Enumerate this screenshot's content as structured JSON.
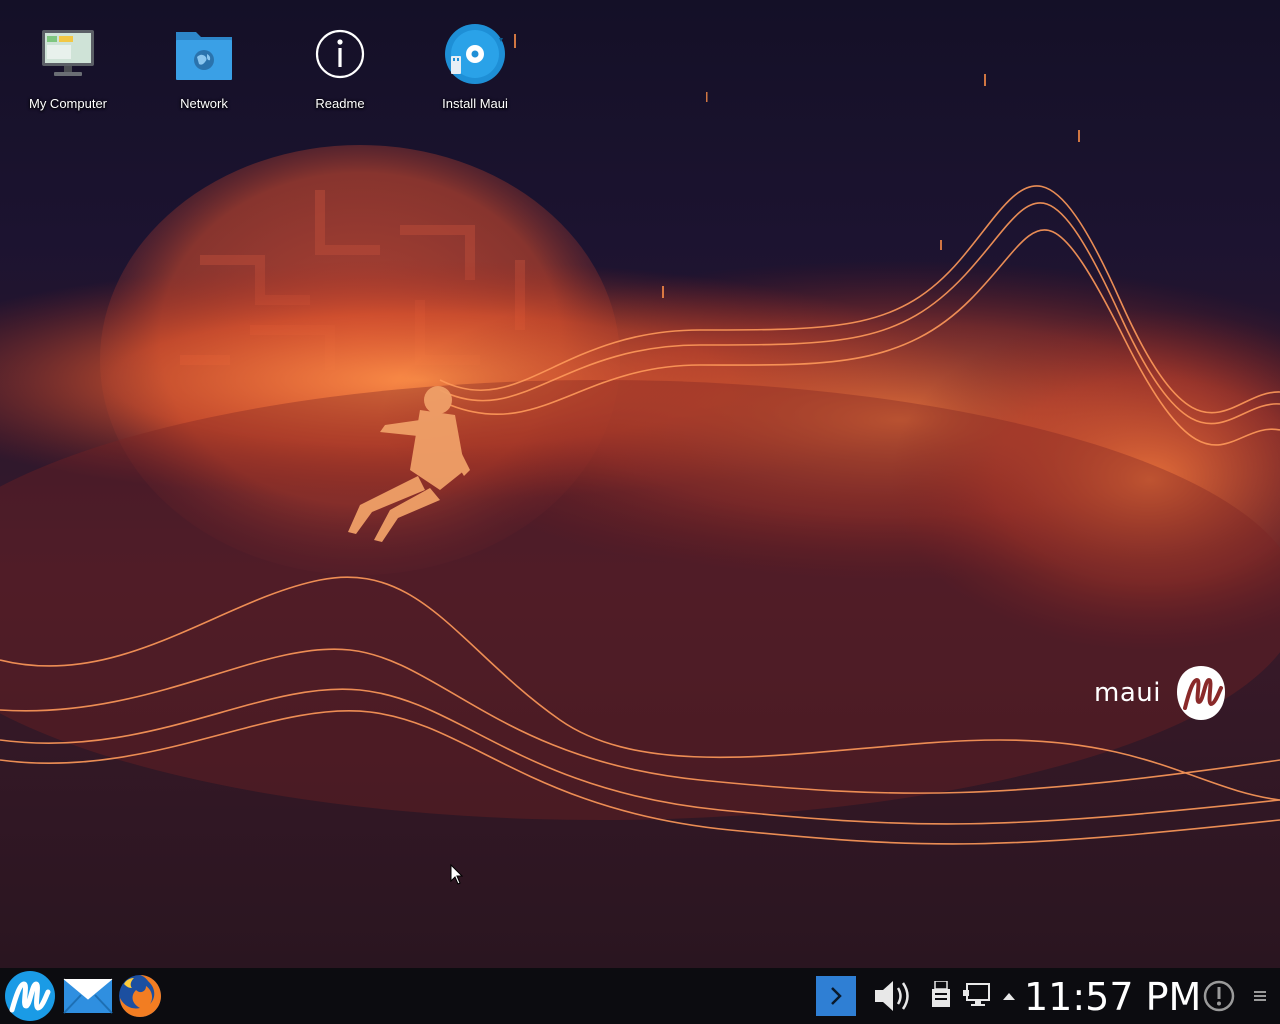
{
  "desktop": {
    "icons": [
      {
        "label": "My Computer",
        "icon": "computer-icon"
      },
      {
        "label": "Network",
        "icon": "network-folder-icon"
      },
      {
        "label": "Readme",
        "icon": "info-icon"
      },
      {
        "label": "Install Maui",
        "icon": "installer-disc-icon"
      }
    ],
    "brand": {
      "text": "maui",
      "logo": "maui-logo-icon"
    }
  },
  "taskbar": {
    "launchers": [
      {
        "name": "Maui menu",
        "icon": "maui-menu-icon"
      },
      {
        "name": "Mail",
        "icon": "mail-icon"
      },
      {
        "name": "Firefox",
        "icon": "firefox-icon"
      }
    ],
    "tray": [
      "terminal-icon",
      "volume-icon",
      "usb-device-icon",
      "network-icon",
      "tray-expand-icon",
      "notifications-icon",
      "panel-menu-icon"
    ],
    "clock": "11:57 PM"
  },
  "colors": {
    "accent": "#f2692f",
    "panel": "#0c0c10",
    "sky": "#160d24",
    "folder": "#3aa0e6",
    "tray_highlight": "#2f7fd4"
  }
}
